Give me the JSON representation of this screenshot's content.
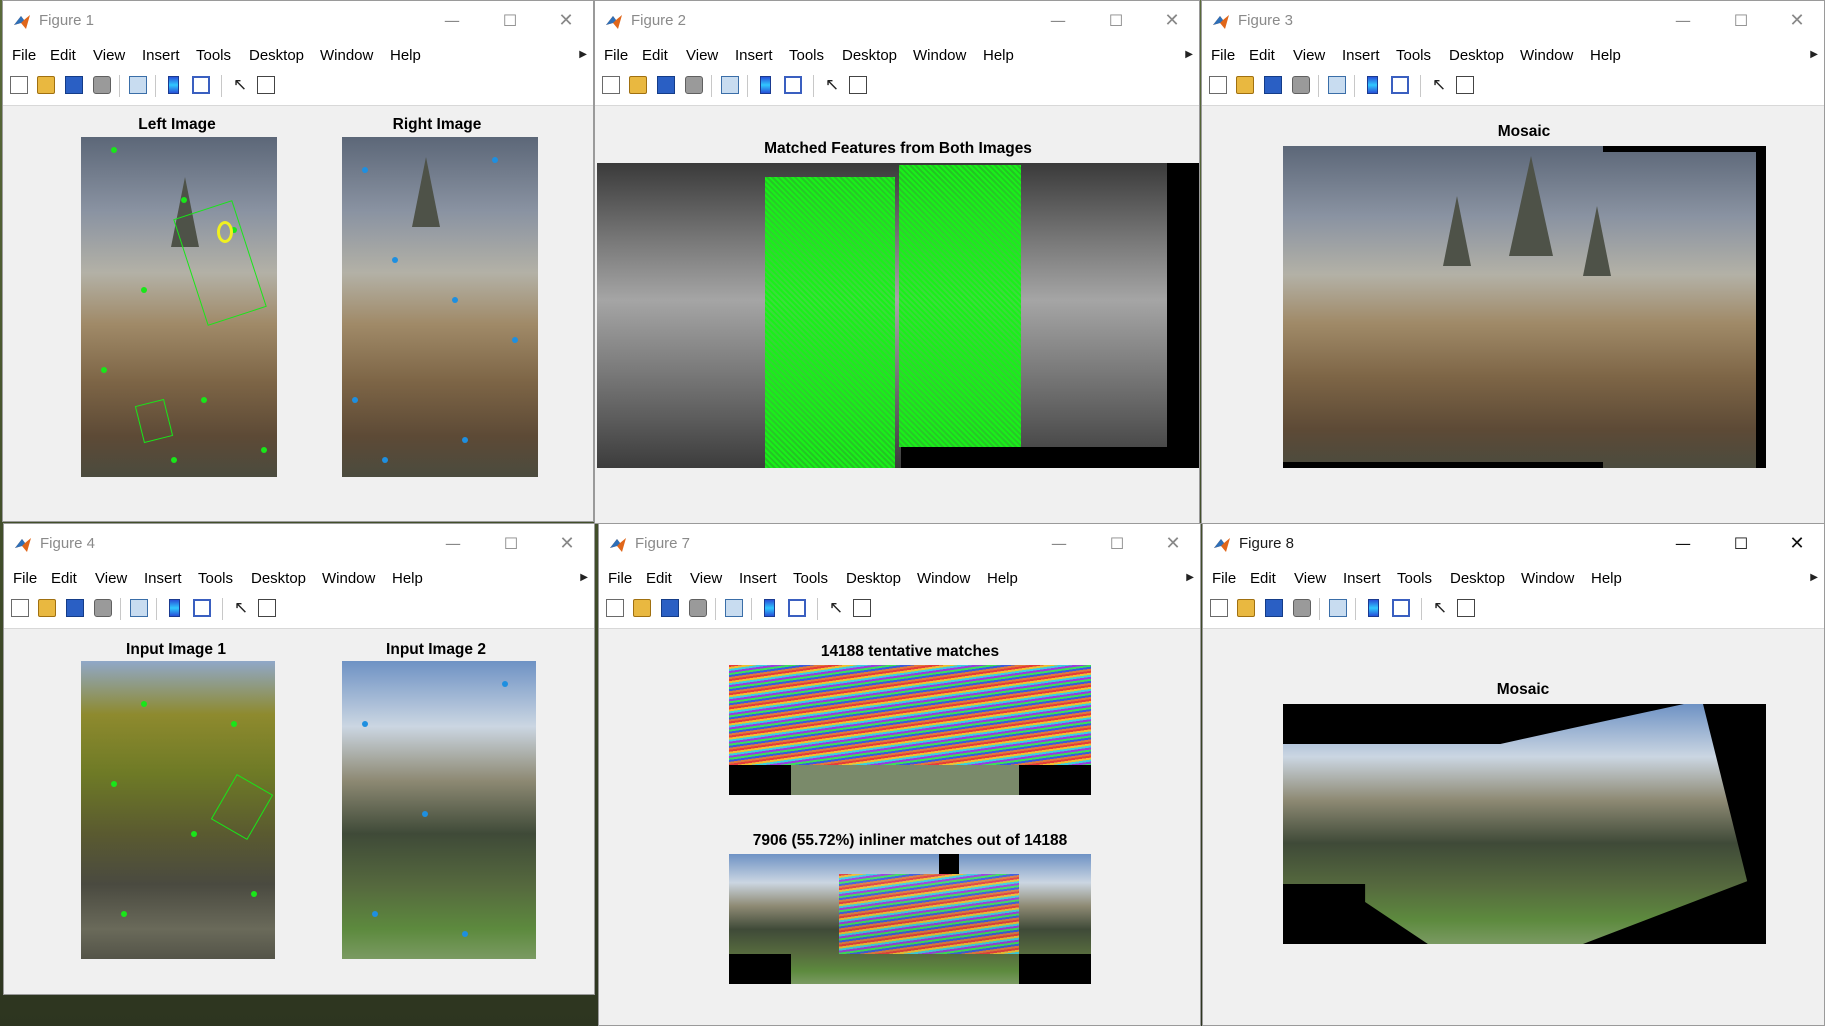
{
  "menus": [
    "File",
    "Edit",
    "View",
    "Insert",
    "Tools",
    "Desktop",
    "Window",
    "Help"
  ],
  "windows": {
    "fig1": {
      "title": "Figure 1",
      "ax1": "Left Image",
      "ax2": "Right Image"
    },
    "fig2": {
      "title": "Figure 2",
      "ax1": "Matched Features from Both Images"
    },
    "fig3": {
      "title": "Figure 3",
      "ax1": "Mosaic"
    },
    "fig4": {
      "title": "Figure 4",
      "ax1": "Input Image 1",
      "ax2": "Input Image 2"
    },
    "fig7": {
      "title": "Figure 7",
      "ax1": "14188 tentative matches",
      "ax2": "7906 (55.72%) inliner matches out of 14188"
    },
    "fig8": {
      "title": "Figure 8",
      "ax1": "Mosaic"
    }
  },
  "window_controls": {
    "minimize": "—",
    "maximize": "☐",
    "close": "✕"
  },
  "colors": {
    "feature_green": "#19e619",
    "feature_blue": "#1e8fe0",
    "window_bg": "#f0f0f0"
  },
  "icons": [
    "new-figure-icon",
    "open-file-icon",
    "save-icon",
    "print-icon",
    "link-plot-icon",
    "colorbar-icon",
    "legend-icon",
    "edit-plot-arrow-icon",
    "property-inspector-icon",
    "matlab-logo-icon"
  ]
}
